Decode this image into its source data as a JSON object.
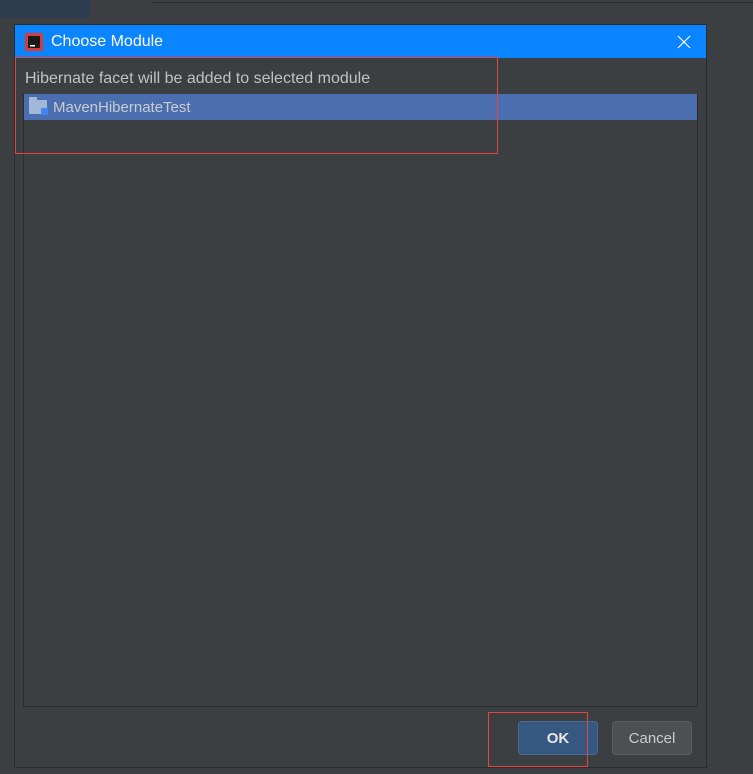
{
  "titlebar": {
    "title": "Choose Module"
  },
  "body": {
    "info_text": "Hibernate facet will be added to selected module",
    "module_name": "MavenHibernateTest"
  },
  "buttons": {
    "ok_label": "OK",
    "cancel_label": "Cancel"
  }
}
